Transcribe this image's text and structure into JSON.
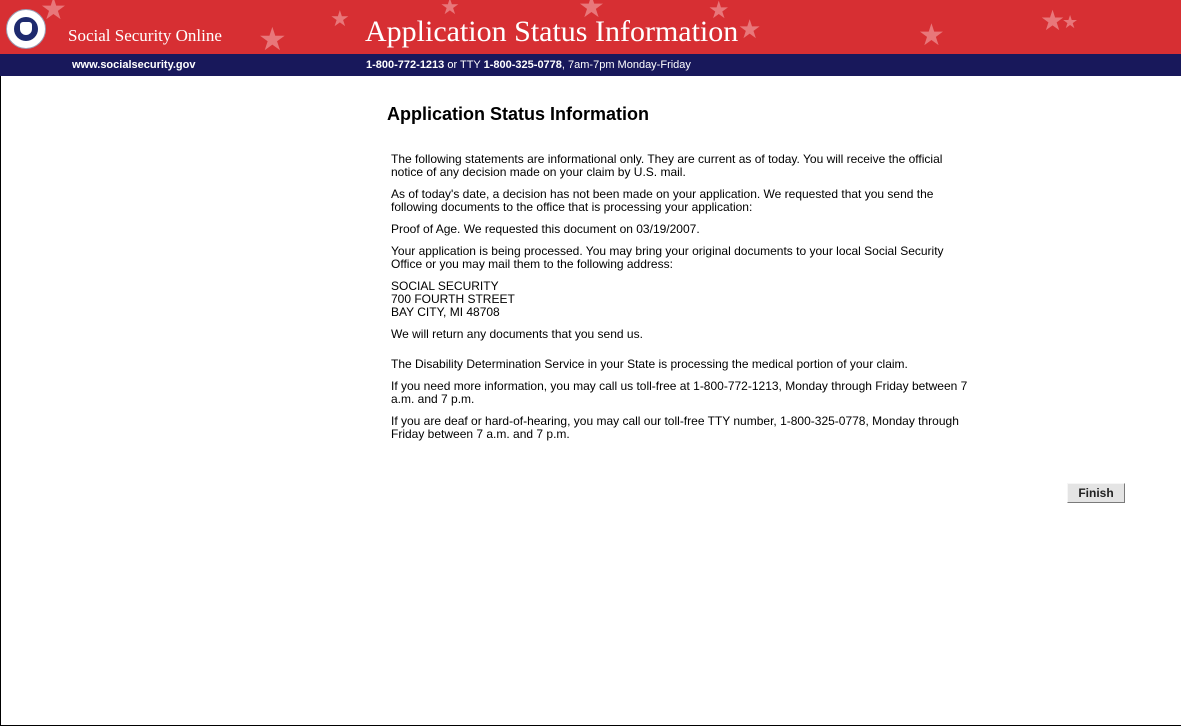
{
  "header": {
    "site_name": "Social Security Online",
    "banner_title": "Application Status Information",
    "site_url": "www.socialsecurity.gov",
    "phone_primary": "1-800-772-1213",
    "phone_or_tty": " or TTY ",
    "phone_tty": "1-800-325-0778",
    "phone_hours": ", 7am-7pm Monday-Friday",
    "seal_icon": "ssa-seal-icon",
    "colors": {
      "banner": "#d72f33",
      "subbar": "#18185b"
    }
  },
  "page": {
    "heading": "Application Status Information",
    "paragraphs": {
      "intro": "The following statements are informational only. They are current as of today. You will receive the official notice of any decision made on your claim by U.S. mail.",
      "decision": "As of today's date, a decision has not been made on your application. We requested that you send the following documents to the office that is processing your application:",
      "proof": "Proof of Age. We requested this document on 03/19/2007.",
      "processing": "Your application is being processed. You may bring your original documents to your local Social Security Office or you may mail them to the following address:",
      "return_docs": "We will return any documents that you send us.",
      "disability": "The Disability Determination Service in your State is processing the medical portion of your claim.",
      "more_info": "If you need more information, you may call us toll-free at 1-800-772-1213, Monday through Friday between 7 a.m. and 7 p.m.",
      "tty_info": "If you are deaf or hard-of-hearing, you may call our toll-free TTY number, 1-800-325-0778, Monday through Friday between 7 a.m. and 7 p.m."
    },
    "address": {
      "line1": "SOCIAL SECURITY",
      "line2": "700 FOURTH STREET",
      "line3": "BAY CITY, MI 48708"
    },
    "finish_label": "Finish"
  }
}
